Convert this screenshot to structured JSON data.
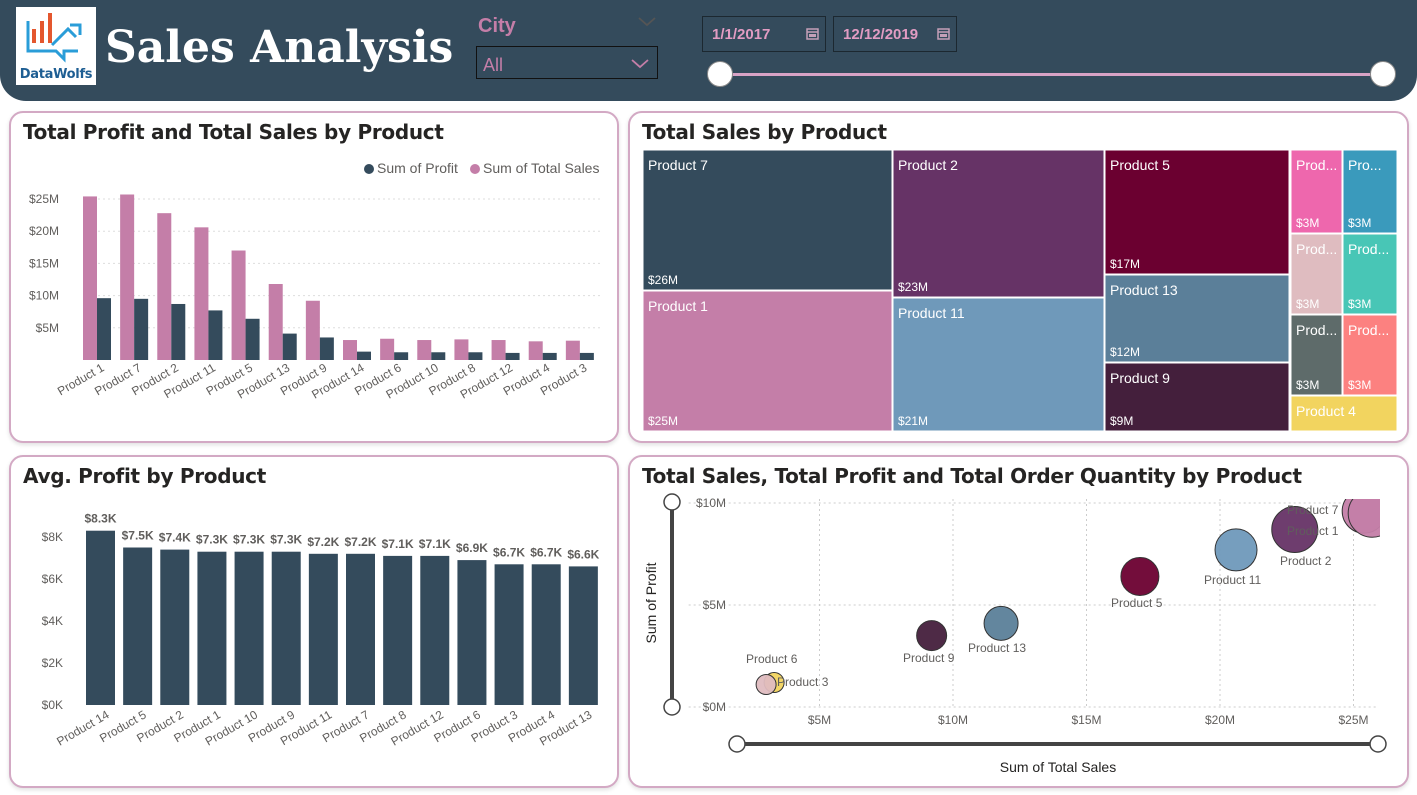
{
  "header": {
    "title": "Sales Analysis",
    "logo_text": "DataWolfs",
    "city_label": "City",
    "city_value": "All",
    "date_start": "1/1/2017",
    "date_end": "12/12/2019",
    "colors": {
      "bar": "#344b5c",
      "accent": "#c47ea8"
    }
  },
  "icons": [
    "chevron-down-icon",
    "calendar-icon",
    "logo-chart-icon"
  ],
  "chart_data": [
    {
      "id": "profit-sales",
      "type": "bar",
      "title": "Total Profit and Total Sales by Product",
      "legend_position": "top-right",
      "categories": [
        "Product 1",
        "Product 7",
        "Product 2",
        "Product 11",
        "Product 5",
        "Product 13",
        "Product 9",
        "Product 14",
        "Product 6",
        "Product 10",
        "Product 8",
        "Product 12",
        "Product 4",
        "Product 3"
      ],
      "series": [
        {
          "name": "Sum of Profit",
          "color": "#344b5c",
          "values": [
            9.6,
            9.5,
            8.7,
            7.7,
            6.4,
            4.1,
            3.5,
            1.3,
            1.2,
            1.2,
            1.2,
            1.1,
            1.1,
            1.1
          ]
        },
        {
          "name": "Sum of Total Sales",
          "color": "#c47ea8",
          "values": [
            25.4,
            25.7,
            22.8,
            20.6,
            17.0,
            11.8,
            9.2,
            3.1,
            3.3,
            3.1,
            3.2,
            3.1,
            2.9,
            3.0
          ]
        }
      ],
      "ylim": [
        0,
        25
      ],
      "yticks": [
        "$5M",
        "$10M",
        "$15M",
        "$20M",
        "$25M"
      ],
      "grid": true
    },
    {
      "id": "treemap",
      "type": "treemap",
      "title": "Total Sales by Product",
      "items": [
        {
          "label": "Product 7",
          "value": "$26M",
          "color": "#344b5c"
        },
        {
          "label": "Product 1",
          "value": "$25M",
          "color": "#c47ea8"
        },
        {
          "label": "Product 2",
          "value": "$23M",
          "color": "#663366"
        },
        {
          "label": "Product 11",
          "value": "$21M",
          "color": "#6f99ba"
        },
        {
          "label": "Product 5",
          "value": "$17M",
          "color": "#6b0030"
        },
        {
          "label": "Product 13",
          "value": "$12M",
          "color": "#5b7f99"
        },
        {
          "label": "Product 9",
          "value": "$9M",
          "color": "#441f3c"
        },
        {
          "label": "Prod...",
          "value": "$3M",
          "color": "#ee67ad"
        },
        {
          "label": "Pro...",
          "value": "$3M",
          "color": "#3a9abc"
        },
        {
          "label": "Prod...",
          "value": "$3M",
          "color": "#dfbcc0"
        },
        {
          "label": "Prod...",
          "value": "$3M",
          "color": "#48c6b6"
        },
        {
          "label": "Prod...",
          "value": "$3M",
          "color": "#5e6b6a"
        },
        {
          "label": "Prod...",
          "value": "$3M",
          "color": "#fc8180"
        },
        {
          "label": "Product 4",
          "value": "",
          "color": "#f2d45f"
        }
      ]
    },
    {
      "id": "avg-profit",
      "type": "bar",
      "title": "Avg. Profit by Product",
      "categories": [
        "Product 14",
        "Product 5",
        "Product 2",
        "Product 1",
        "Product 10",
        "Product 9",
        "Product 11",
        "Product 7",
        "Product 8",
        "Product 12",
        "Product 6",
        "Product 3",
        "Product 4",
        "Product 13"
      ],
      "values": [
        8.3,
        7.5,
        7.4,
        7.3,
        7.3,
        7.3,
        7.2,
        7.2,
        7.1,
        7.1,
        6.9,
        6.7,
        6.7,
        6.6
      ],
      "data_labels": [
        "$8.3K",
        "$7.5K",
        "$7.4K",
        "$7.3K",
        "$7.3K",
        "$7.3K",
        "$7.2K",
        "$7.2K",
        "$7.1K",
        "$7.1K",
        "$6.9K",
        "$6.7K",
        "$6.7K",
        "$6.6K"
      ],
      "ylim": [
        0,
        8.3
      ],
      "yticks": [
        "$0K",
        "$2K",
        "$4K",
        "$6K",
        "$8K"
      ],
      "color": "#344b5c"
    },
    {
      "id": "scatter",
      "type": "scatter",
      "title": "Total Sales, Total Profit and Total Order Quantity by Product",
      "xlabel": "Sum of Total Sales",
      "ylabel": "Sum of Profit",
      "xticks": [
        "$5M",
        "$10M",
        "$15M",
        "$20M",
        "$25M"
      ],
      "yticks": [
        "$0M",
        "$5M",
        "$10M"
      ],
      "xlim": [
        0.1,
        26
      ],
      "ylim": [
        0,
        10
      ],
      "points": [
        {
          "label": "Product 7",
          "x": 25.7,
          "y": 9.5,
          "r": 24,
          "color": "#c47ea8"
        },
        {
          "label": "Product 1",
          "x": 25.4,
          "y": 9.6,
          "r": 22,
          "color": "#c47ea8"
        },
        {
          "label": "Product 2",
          "x": 22.8,
          "y": 8.7,
          "r": 23,
          "color": "#663366"
        },
        {
          "label": "Product 11",
          "x": 20.6,
          "y": 7.7,
          "r": 21,
          "color": "#6f99ba"
        },
        {
          "label": "Product 5",
          "x": 17.0,
          "y": 6.4,
          "r": 19,
          "color": "#6b0030"
        },
        {
          "label": "Product 13",
          "x": 11.8,
          "y": 4.1,
          "r": 17,
          "color": "#5b7f99"
        },
        {
          "label": "Product 9",
          "x": 9.2,
          "y": 3.5,
          "r": 15,
          "color": "#441f3c"
        },
        {
          "label": "Product 6",
          "x": 3.3,
          "y": 1.2,
          "r": 10,
          "color": "#f2d45f"
        },
        {
          "label": "Product 3",
          "x": 3.0,
          "y": 1.1,
          "r": 10,
          "color": "#dfbcc0"
        }
      ]
    }
  ]
}
